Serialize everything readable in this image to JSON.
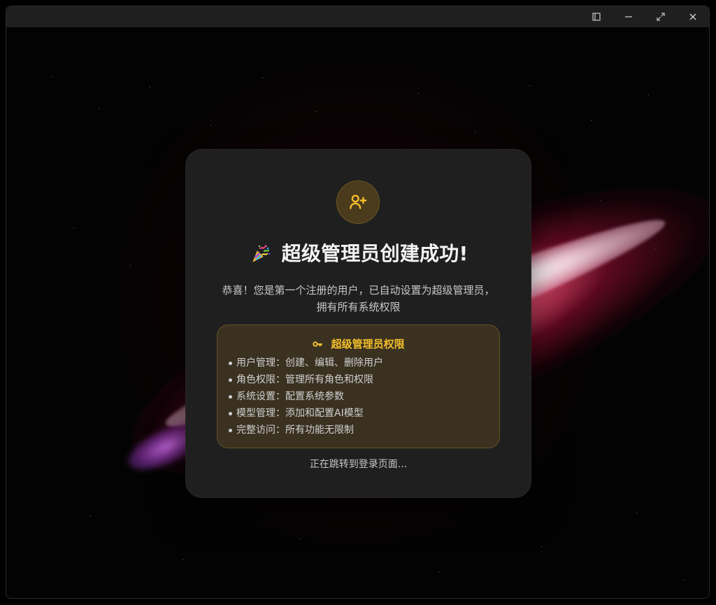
{
  "window": {
    "controls": {
      "sidebar_icon": "sidebar-icon",
      "minimize_icon": "minimize-icon",
      "maximize_icon": "maximize-icon",
      "close_icon": "close-icon"
    }
  },
  "dialog": {
    "icon": "user-plus-icon",
    "title_emoji": "party-popper-icon",
    "title": "超级管理员创建成功!",
    "subtitle_lines": [
      "恭喜！您是第一个注册的用户，已自动设置为超级管理员，",
      "拥有所有系统权限"
    ],
    "permissions": {
      "icon": "key-icon",
      "title": "超级管理员权限",
      "items": [
        "用户管理：创建、编辑、删除用户",
        "角色权限：管理所有角色和权限",
        "系统设置：配置系统参数",
        "模型管理：添加和配置AI模型",
        "完整访问：所有功能无限制"
      ]
    },
    "redirect_text": "正在跳转到登录页面..."
  },
  "colors": {
    "background": "#040303",
    "dialog_bg": "#1f1f1f",
    "accent_gold": "#f3bf2b",
    "panel_bg": "#3a3121",
    "text_primary": "#f3f3f3",
    "text_secondary": "#c8c8c8"
  }
}
